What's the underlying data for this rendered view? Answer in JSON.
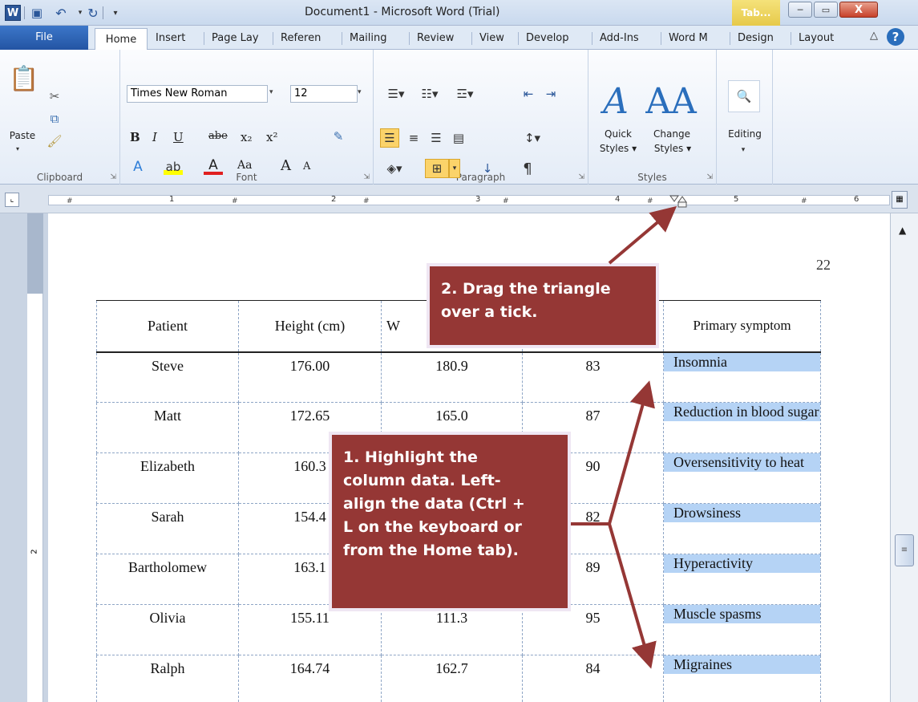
{
  "titlebar": {
    "title": "Document1 - Microsoft Word (Trial)",
    "contextual_tab": "Tab...",
    "app_icon": "W",
    "minimize": "─",
    "maximize": "▭",
    "close": "X"
  },
  "tabs": {
    "file": "File",
    "home": "Home",
    "insert": "Insert",
    "page_layout": "Page Lay",
    "references": "Referen",
    "mailings": "Mailing",
    "review": "Review",
    "view": "View",
    "developer": "Develop",
    "add_ins": "Add-Ins",
    "word_m": "Word M",
    "design": "Design",
    "layout": "Layout"
  },
  "ribbon": {
    "clipboard": {
      "label": "Clipboard",
      "paste": "Paste"
    },
    "font": {
      "label": "Font",
      "name": "Times New Roman",
      "size": "12",
      "bold": "B",
      "italic": "I",
      "underline": "U",
      "strike": "abe",
      "subscript": "x₂",
      "superscript": "x²",
      "grow": "A",
      "shrink": "A",
      "change_case": "Aa"
    },
    "paragraph": {
      "label": "Paragraph",
      "pilcrow": "¶"
    },
    "styles": {
      "label": "Styles",
      "quick": "Quick",
      "quick2": "Styles ▾",
      "change": "Change",
      "change2": "Styles ▾"
    },
    "editing": {
      "label": "Editing"
    }
  },
  "ruler": {
    "n1": "1",
    "n2": "2",
    "n3": "3",
    "n4": "4",
    "n5": "5",
    "n6": "6"
  },
  "vruler": {
    "n2": "2"
  },
  "page": {
    "number": "22"
  },
  "table": {
    "headers": [
      "Patient",
      "Height (cm)",
      "W",
      "",
      "Primary symptom"
    ],
    "rows": [
      [
        "Steve",
        "176.00",
        "180.9",
        "83",
        "Insomnia"
      ],
      [
        "Matt",
        "172.65",
        "165.0",
        "87",
        "Reduction in blood sugar"
      ],
      [
        "Elizabeth",
        "160.3",
        "",
        "90",
        "Oversensitivity to heat"
      ],
      [
        "Sarah",
        "154.4",
        "",
        "82",
        "Drowsiness"
      ],
      [
        "Bartholomew",
        "163.1",
        "",
        "89",
        "Hyperactivity"
      ],
      [
        "Olivia",
        "155.11",
        "111.3",
        "95",
        "Muscle spasms"
      ],
      [
        "Ralph",
        "164.74",
        "162.7",
        "84",
        "Migraines"
      ]
    ]
  },
  "callouts": {
    "step2_line1": "2. Drag the triangle",
    "step2_line2": "over a tick.",
    "step1_line1": "1. Highlight the",
    "step1_line2": "column data. Left-",
    "step1_line3": "align the data (Ctrl +",
    "step1_line4": "L on the keyboard or",
    "step1_line5": "from the Home tab)."
  },
  "colors": {
    "callout": "#953735",
    "highlight": "#b5d3f5",
    "arrow": "#953735",
    "file_tab": "#2a5699"
  }
}
